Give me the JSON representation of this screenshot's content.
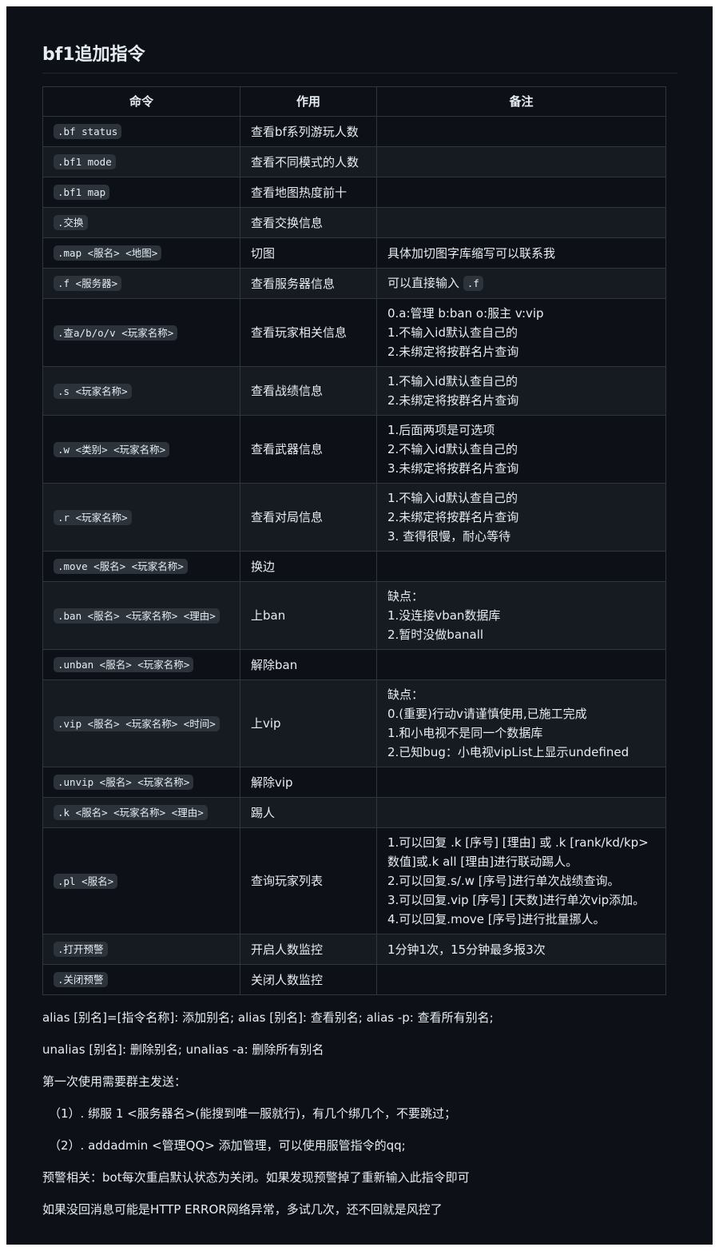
{
  "title": "bf1追加指令",
  "table": {
    "headers": [
      "命令",
      "作用",
      "备注"
    ],
    "rows": [
      {
        "cmd": ".bf status",
        "desc": "查看bf系列游玩人数",
        "notes": []
      },
      {
        "cmd": ".bf1 mode",
        "desc": "查看不同模式的人数",
        "notes": []
      },
      {
        "cmd": ".bf1 map",
        "desc": "查看地图热度前十",
        "notes": []
      },
      {
        "cmd": ".交换",
        "desc": "查看交换信息",
        "notes": []
      },
      {
        "cmd": ".map <服名> <地图>",
        "desc": "切图",
        "notes": [
          "具体加切图字库缩写可以联系我"
        ]
      },
      {
        "cmd": ".f <服务器>",
        "desc": "查看服务器信息",
        "notes": [
          "可以直接输入"
        ],
        "note_code": ".f"
      },
      {
        "cmd": ".查a/b/o/v <玩家名称>",
        "desc": "查看玩家相关信息",
        "notes": [
          "0.a:管理 b:ban o:服主 v:vip",
          "1.不输入id默认查自己的",
          "2.未绑定将按群名片查询"
        ]
      },
      {
        "cmd": ".s <玩家名称>",
        "desc": "查看战绩信息",
        "notes": [
          "1.不输入id默认查自己的",
          "2.未绑定将按群名片查询"
        ]
      },
      {
        "cmd": ".w <类别> <玩家名称>",
        "desc": "查看武器信息",
        "notes": [
          "1.后面两项是可选项",
          "2.不输入id默认查自己的",
          "3.未绑定将按群名片查询"
        ]
      },
      {
        "cmd": ".r <玩家名称>",
        "desc": "查看对局信息",
        "notes": [
          "1.不输入id默认查自己的",
          "2.未绑定将按群名片查询",
          "3. 查得很慢，耐心等待"
        ]
      },
      {
        "cmd": ".move <服名> <玩家名称>",
        "desc": "换边",
        "notes": []
      },
      {
        "cmd": ".ban <服名> <玩家名称> <理由>",
        "desc": "上ban",
        "notes": [
          "缺点：",
          "1.没连接vban数据库",
          "2.暂时没做banall"
        ]
      },
      {
        "cmd": ".unban <服名> <玩家名称>",
        "desc": "解除ban",
        "notes": []
      },
      {
        "cmd": ".vip <服名> <玩家名称> <时间>",
        "desc": "上vip",
        "notes": [
          "缺点：",
          "0.(重要)行动v请谨慎使用,已施工完成",
          "1.和小电视不是同一个数据库",
          "2.已知bug：小电视vipList上显示undefined"
        ]
      },
      {
        "cmd": ".unvip <服名> <玩家名称>",
        "desc": "解除vip",
        "notes": []
      },
      {
        "cmd": ".k <服名> <玩家名称> <理由>",
        "desc": "踢人",
        "notes": []
      },
      {
        "cmd": ".pl <服名>",
        "desc": "查询玩家列表",
        "notes": [
          "1.可以回复 .k [序号] [理由] 或 .k [rank/kd/kp>数值]或.k all [理由]进行联动踢人。",
          "2.可以回复.s/.w [序号]进行单次战绩查询。",
          "3.可以回复.vip [序号] [天数]进行单次vip添加。",
          "4.可以回复.move [序号]进行批量挪人。"
        ]
      },
      {
        "cmd": ".打开预警",
        "desc": "开启人数监控",
        "notes": [
          "1分钟1次，15分钟最多报3次"
        ]
      },
      {
        "cmd": ".关闭预警",
        "desc": "关闭人数监控",
        "notes": []
      }
    ]
  },
  "paragraphs": [
    {
      "text": "alias [别名]=[指令名称]: 添加别名; alias [别名]: 查看别名; alias -p: 查看所有别名;",
      "indent": false
    },
    {
      "text": "unalias [别名]: 删除别名; unalias -a: 删除所有别名",
      "indent": false
    },
    {
      "text": "第一次使用需要群主发送：",
      "indent": false
    },
    {
      "text": "（1）. 绑服 1 <服务器名>(能搜到唯一服就行)，有几个绑几个，不要跳过；",
      "indent": true
    },
    {
      "text": "（2）. addadmin <管理QQ> 添加管理，可以使用服管指令的qq;",
      "indent": true
    },
    {
      "text": "预警相关：bot每次重启默认状态为关闭。如果发现预警掉了重新输入此指令即可",
      "indent": false
    },
    {
      "text": "如果没回消息可能是HTTP ERROR网络异常，多试几次，还不回就是风控了",
      "indent": false
    }
  ]
}
